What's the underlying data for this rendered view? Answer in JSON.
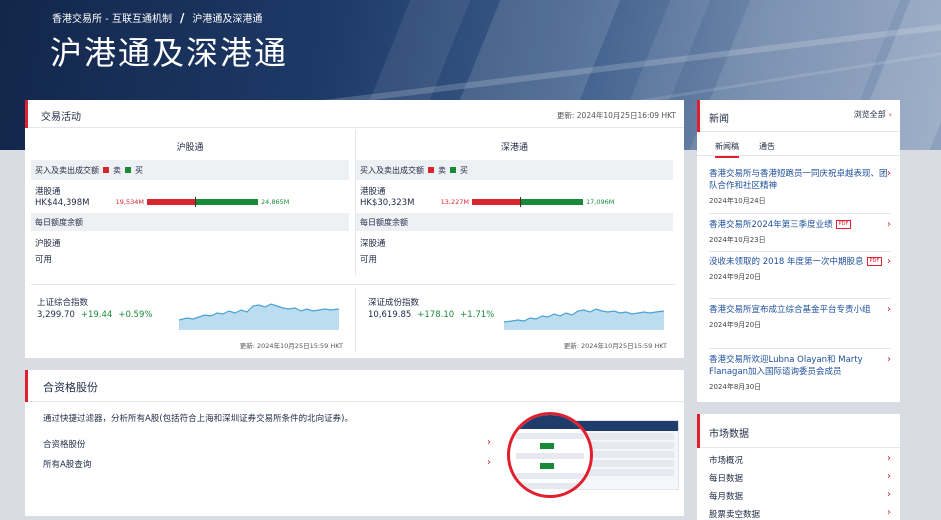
{
  "breadcrumb": {
    "parent": "香港交易所 - 互联互通机制",
    "current": "沪港通及深港通"
  },
  "page_title": "沪港通及深港通",
  "trading": {
    "title": "交易活动",
    "updated": "更新: 2024年10月25日16:09 HKT",
    "left": {
      "title": "沪股通",
      "flow_label": "买入及卖出成交额",
      "sell_label": "卖",
      "buy_label": "买",
      "connect_name": "港股通",
      "connect_value": "HK$44,398M",
      "sell_value": "19,534M",
      "buy_value": "24,865M",
      "sell_amount": 19534,
      "buy_amount": 24865,
      "daily_quota": "每日额度余额",
      "quota_name": "沪股通",
      "quota_status": "可用"
    },
    "right": {
      "title": "深港通",
      "flow_label": "买入及卖出成交额",
      "sell_label": "卖",
      "buy_label": "买",
      "connect_name": "港股通",
      "connect_value": "HK$30,323M",
      "sell_value": "13,227M",
      "buy_value": "17,096M",
      "sell_amount": 13227,
      "buy_amount": 17096,
      "daily_quota": "每日额度余额",
      "quota_name": "深股通",
      "quota_status": "可用"
    },
    "index_left": {
      "name": "上证综合指数",
      "value": "3,299.70",
      "change": "+19.44",
      "pct": "+0.59%",
      "updated": "更新: 2024年10月25日15:59 HKT"
    },
    "index_right": {
      "name": "深证成份指数",
      "value": "10,619.85",
      "change": "+178.10",
      "pct": "+1.71%",
      "updated": "更新: 2024年10月25日15:59 HKT"
    }
  },
  "eligible": {
    "title": "合资格股份",
    "description": "通过快捷过滤器，分析所有A股(包括符合上海和深圳证券交易所条件的北向证券)。",
    "links": [
      "合资格股份",
      "所有A股查询"
    ]
  },
  "news": {
    "title": "新闻",
    "view_all": "浏览全部",
    "tabs": [
      "新闻稿",
      "通告"
    ],
    "items": [
      {
        "title": "香港交易所与香港短跑员一同庆祝卓越表现、团队合作和社区精神",
        "date": "2024年10月24日",
        "pdf": ""
      },
      {
        "title": "香港交易所2024年第三季度业绩",
        "date": "2024年10月23日",
        "pdf": "PDF"
      },
      {
        "title": "没收未领取的 2018 年度第一次中期股息",
        "date": "2024年9月20日",
        "pdf": "PDF"
      },
      {
        "title": "香港交易所宣布成立综合基金平台专责小组",
        "date": "2024年9月20日",
        "pdf": ""
      },
      {
        "title": "香港交易所欢迎Lubna Olayan和 Marty Flanagan加入国际谘询委员会成员",
        "date": "2024年8月30日",
        "pdf": ""
      }
    ]
  },
  "market": {
    "title": "市场数据",
    "items": [
      "市场概况",
      "每日数据",
      "每月数据",
      "股票卖空数据"
    ]
  }
}
